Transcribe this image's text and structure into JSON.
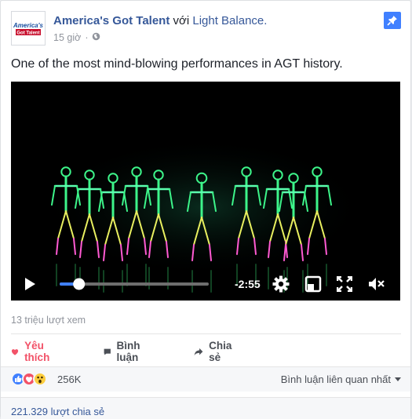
{
  "post": {
    "page_name": "America's Got Talent",
    "with_text": " với ",
    "tagged": "Light Balance.",
    "time": "15 giờ",
    "privacy_icon": "globe-icon",
    "text": "One of the most mind-blowing performances in AGT history.",
    "logo_top": "America's",
    "logo_bottom": "Got Talent"
  },
  "video": {
    "time_remaining": "-2:55",
    "progress": 0.13,
    "icons": [
      "play-icon",
      "settings-icon",
      "minimize-icon",
      "fullscreen-icon",
      "mute-icon"
    ]
  },
  "stats": {
    "views": "13 triệu lượt xem"
  },
  "actions": {
    "like": "Yêu thích",
    "comment": "Bình luận",
    "share": "Chia sẻ"
  },
  "reactions": {
    "count": "256K",
    "sort_label": "Bình luận liên quan nhất",
    "colors": {
      "like": "#4080ff",
      "love": "#f25268",
      "wow": "#fccd3e"
    }
  },
  "shares": {
    "text": "221.329 lượt chia sẻ"
  }
}
